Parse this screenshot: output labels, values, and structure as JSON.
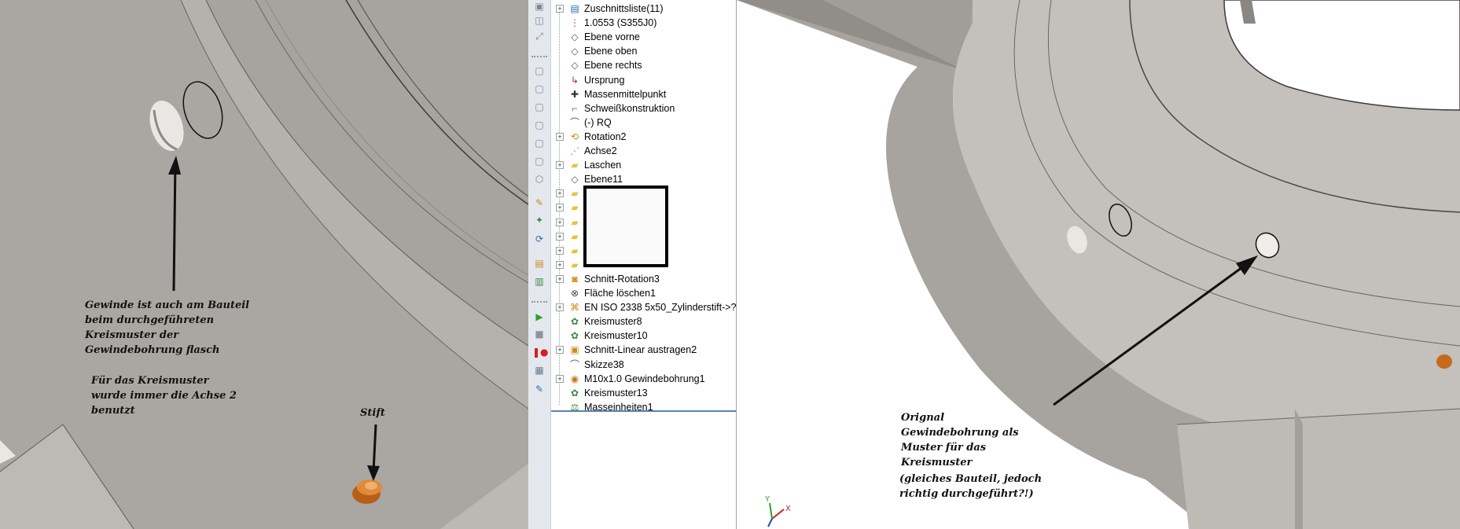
{
  "left_view": {
    "annotation_thread": "Gewinde ist auch am Bauteil\nbeim durchgeführeten\nKreismuster der\nGewindebohrung flasch",
    "annotation_axis": "Für das Kreismuster\nwurde immer die Achse 2\nbenutzt",
    "annotation_pin": "Stift"
  },
  "right_view": {
    "annotation_original": "Orignal\nGewindebohrung als\nMuster für das\nKreismuster",
    "annotation_note": "(gleiches Bauteil, jedoch\nrichtig durchgeführt?!)",
    "triad_x": "X",
    "triad_y": "Y"
  },
  "feature_tree": {
    "items": [
      {
        "label": "Zuschnittsliste(11)",
        "icon": "cut-list-icon",
        "expandable": true
      },
      {
        "label": "1.0553 (S355J0)",
        "icon": "material-icon",
        "expandable": false
      },
      {
        "label": "Ebene vorne",
        "icon": "plane-icon",
        "expandable": false
      },
      {
        "label": "Ebene oben",
        "icon": "plane-icon",
        "expandable": false
      },
      {
        "label": "Ebene rechts",
        "icon": "plane-icon",
        "expandable": false
      },
      {
        "label": "Ursprung",
        "icon": "origin-icon",
        "expandable": false
      },
      {
        "label": "Massenmittelpunkt",
        "icon": "center-of-mass-icon",
        "expandable": false
      },
      {
        "label": "Schweißkonstruktion",
        "icon": "weldment-icon",
        "expandable": false
      },
      {
        "label": "(-) RQ",
        "icon": "sketch-icon",
        "expandable": false
      },
      {
        "label": "Rotation2",
        "icon": "revolve-icon",
        "expandable": true
      },
      {
        "label": "Achse2",
        "icon": "axis-icon",
        "expandable": false
      },
      {
        "label": "Laschen",
        "icon": "folder-icon",
        "expandable": true
      },
      {
        "label": "Ebene11",
        "icon": "plane-icon",
        "expandable": false
      },
      {
        "label": "",
        "icon": "folder-icon",
        "expandable": true
      },
      {
        "label": "",
        "icon": "folder-icon",
        "expandable": true
      },
      {
        "label": "",
        "icon": "folder-icon",
        "expandable": true
      },
      {
        "label": "",
        "icon": "folder-icon",
        "expandable": true
      },
      {
        "label": "",
        "icon": "folder-icon",
        "expandable": true
      },
      {
        "label": "",
        "icon": "folder-icon",
        "expandable": true
      },
      {
        "label": "Schnitt-Rotation3",
        "icon": "cut-revolve-icon",
        "expandable": true
      },
      {
        "label": "Fläche löschen1",
        "icon": "delete-face-icon",
        "expandable": false
      },
      {
        "label": "EN ISO 2338 5x50_Zylinderstift->?",
        "icon": "part-icon",
        "expandable": true
      },
      {
        "label": "Kreismuster8",
        "icon": "circular-pattern-icon",
        "expandable": false
      },
      {
        "label": "Kreismuster10",
        "icon": "circular-pattern-icon",
        "expandable": false
      },
      {
        "label": "Schnitt-Linear austragen2",
        "icon": "cut-extrude-icon",
        "expandable": true
      },
      {
        "label": "Skizze38",
        "icon": "sketch-icon",
        "expandable": false
      },
      {
        "label": "M10x1.0 Gewindebohrung1",
        "icon": "hole-wizard-icon",
        "expandable": true
      },
      {
        "label": "Kreismuster13",
        "icon": "circular-pattern-icon",
        "expandable": false
      },
      {
        "label": "Masseinheiten1",
        "icon": "units-icon",
        "expandable": false
      }
    ]
  },
  "toolbar_icons": [
    "display-icon",
    "section-icon",
    "smart-dimension-icon",
    "view-front-icon",
    "view-back-icon",
    "view-left-icon",
    "view-right-icon",
    "view-top-icon",
    "view-bottom-icon",
    "view-iso-icon",
    "edit-sketch-icon",
    "reference-icon",
    "rebuild-icon",
    "add-feature-icon",
    "insert-part-icon",
    "play-icon",
    "stop-icon",
    "record-icon",
    "macro-icon",
    "edit-macro-icon"
  ],
  "colors": {
    "model_gray": "#a9a6a1",
    "pin_orange": "#c46a1e",
    "selection_blue": "#5a83b5"
  }
}
